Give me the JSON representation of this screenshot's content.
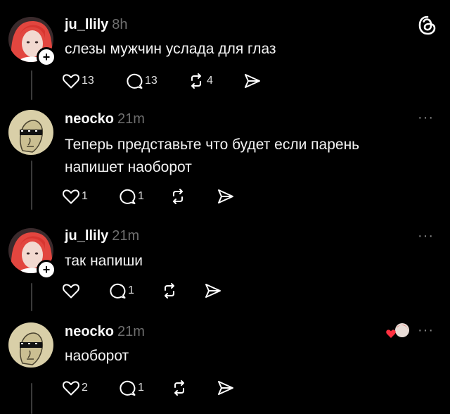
{
  "app": {
    "logo_icon": "threads-logo-icon"
  },
  "posts": [
    {
      "username": "ju_llily",
      "time": "8h",
      "text": [
        "слезы мужчин услада для глаз"
      ],
      "likes": "13",
      "comments": "13",
      "reposts": "4",
      "avatar": "red-hair-avatar",
      "follow_badge": "+"
    },
    {
      "username": "neocko",
      "time": "21m",
      "text": [
        "Теперь представьте что будет если парень",
        "напишет наоборот"
      ],
      "likes": "1",
      "comments": "1",
      "reposts": "",
      "avatar": "meme-face-avatar",
      "more": "···"
    },
    {
      "username": "ju_llily",
      "time": "21m",
      "text": [
        "так напиши"
      ],
      "likes": "",
      "comments": "1",
      "reposts": "",
      "avatar": "red-hair-avatar",
      "follow_badge": "+",
      "more": "···"
    },
    {
      "username": "neocko",
      "time": "21m",
      "text": [
        "наоборот"
      ],
      "likes": "2",
      "comments": "1",
      "reposts": "",
      "avatar": "meme-face-avatar",
      "more": "···",
      "liked_by_author": true
    }
  ],
  "colors": {
    "background": "#000000",
    "text": "#f3f3f3",
    "muted": "#6f6f6f",
    "thread_line": "#3a3a3a",
    "heart": "#ff3040"
  }
}
